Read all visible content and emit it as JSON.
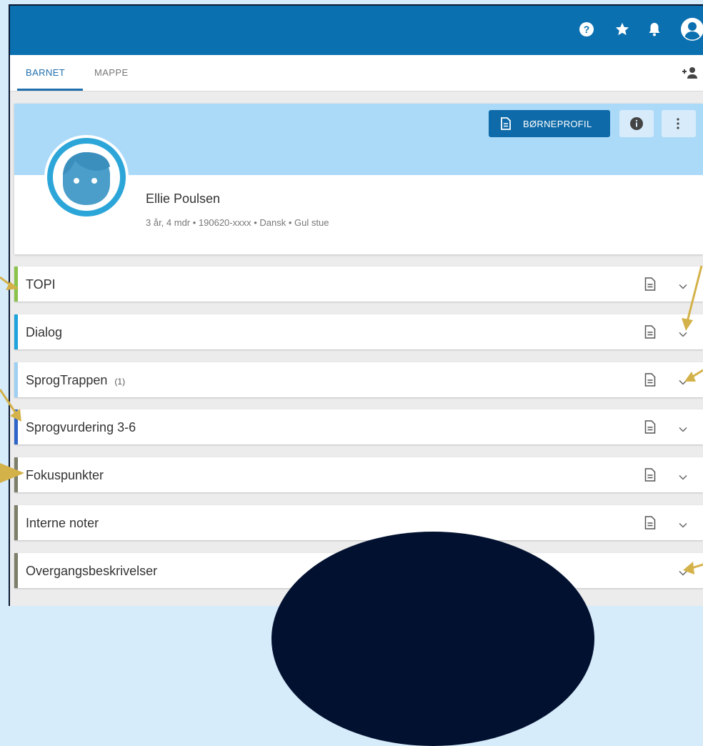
{
  "header": {
    "icons": [
      "help-icon",
      "star-icon",
      "bell-icon",
      "account-icon"
    ]
  },
  "tabs": [
    {
      "label": "BARNET",
      "active": true
    },
    {
      "label": "MAPPE",
      "active": false
    }
  ],
  "profile": {
    "button_label": "BØRNEPROFIL",
    "name": "Ellie Poulsen",
    "meta": "3 år, 4 mdr • 190620-xxxx • Dansk • Gul stue"
  },
  "sections": [
    {
      "title": "TOPI",
      "count": "",
      "color": "#8bc34a",
      "has_doc": true
    },
    {
      "title": "Dialog",
      "count": "",
      "color": "#1ea3dd",
      "has_doc": true
    },
    {
      "title": "SprogTrappen",
      "count": "(1)",
      "color": "#9fd0f2",
      "has_doc": true
    },
    {
      "title": "Sprogvurdering 3-6",
      "count": "",
      "color": "#2f65c8",
      "has_doc": true
    },
    {
      "title": "Fokuspunkter",
      "count": "",
      "color": "#7d7f6a",
      "has_doc": true
    },
    {
      "title": "Interne noter",
      "count": "",
      "color": "#7d7f6a",
      "has_doc": true
    },
    {
      "title": "Overgangsbeskrivelser",
      "count": "",
      "color": "#7d7f6a",
      "has_doc": false
    }
  ],
  "colors": {
    "brand": "#0b70b0",
    "banner": "#abdaf9",
    "arrow": "#d4b24a",
    "overlay": "#021130"
  }
}
